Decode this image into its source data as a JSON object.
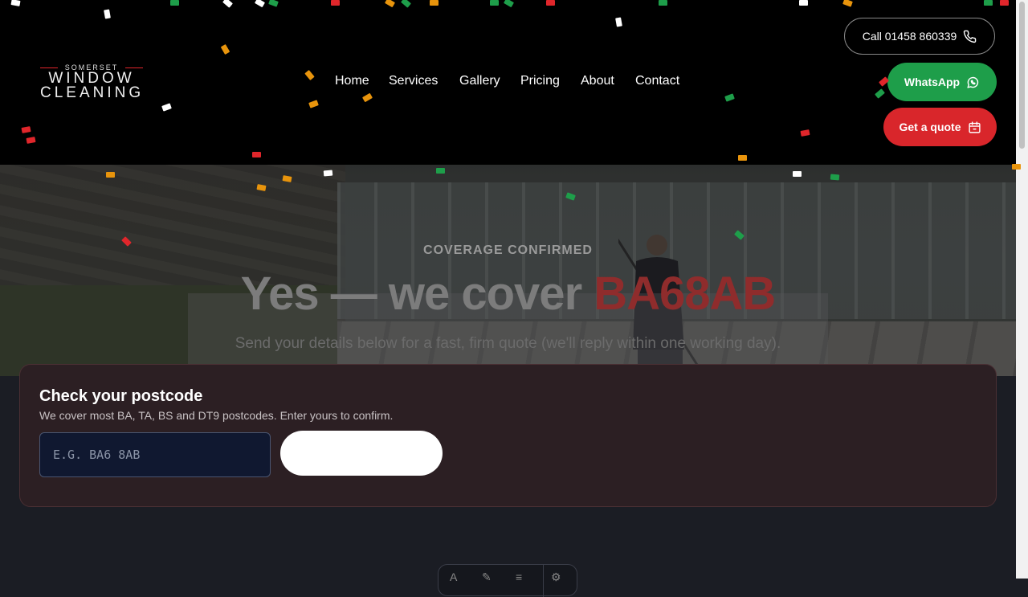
{
  "header": {
    "logo": {
      "top": "SOMERSET",
      "middle": "WINDOW",
      "bottom": "CLEANING"
    },
    "nav": [
      "Home",
      "Services",
      "Gallery",
      "Pricing",
      "About",
      "Contact"
    ],
    "call_label": "Call 01458 860339",
    "whatsapp_label": "WhatsApp",
    "quote_label": "Get a quote"
  },
  "hero": {
    "kicker": "COVERAGE CONFIRMED",
    "headline_prefix": "Yes — we cover ",
    "headline_postcode": "BA68AB",
    "subtext": "Send your details below for a fast, firm quote (we'll reply within one working day)."
  },
  "postcode_check": {
    "title": "Check your postcode",
    "description": "We cover most BA, TA, BS and DT9 postcodes. Enter yours to confirm.",
    "input_value": "",
    "input_placeholder": "E.G. BA6 8AB",
    "button_label": ""
  },
  "colors": {
    "accent_red": "#d9262b",
    "whatsapp_green": "#1e9e4a",
    "header_bg": "#000000",
    "page_bg": "#1b1d24"
  },
  "icons": {
    "call": "phone-icon",
    "whatsapp": "whatsapp-icon",
    "quote": "calendar-icon"
  }
}
